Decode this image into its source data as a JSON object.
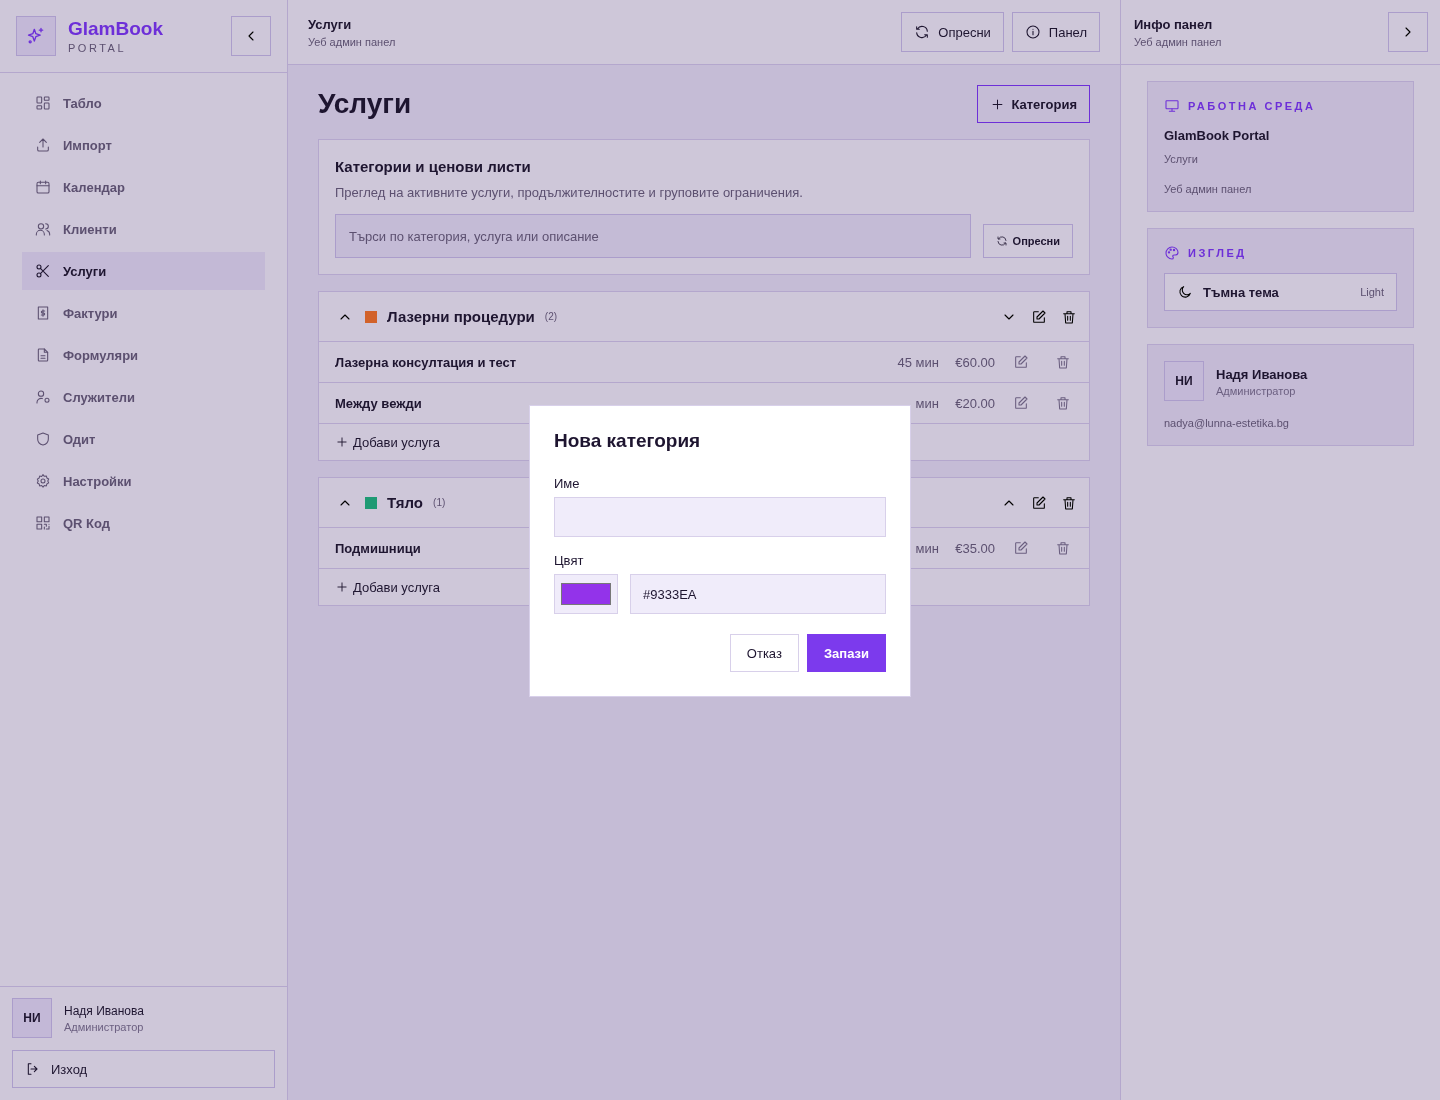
{
  "sidebar": {
    "brand": {
      "name": "GlamBook",
      "tagline": "PORTAL"
    },
    "items": [
      {
        "label": "Табло",
        "selected": false
      },
      {
        "label": "Импорт",
        "selected": false
      },
      {
        "label": "Календар",
        "selected": false
      },
      {
        "label": "Клиенти",
        "selected": false
      },
      {
        "label": "Услуги",
        "selected": true
      },
      {
        "label": "Фактури",
        "selected": false
      },
      {
        "label": "Формуляри",
        "selected": false
      },
      {
        "label": "Служители",
        "selected": false
      },
      {
        "label": "Одит",
        "selected": false
      },
      {
        "label": "Настройки",
        "selected": false
      },
      {
        "label": "QR Код",
        "selected": false
      }
    ],
    "user": {
      "initials": "НИ",
      "name": "Надя Иванова",
      "role": "Администратор"
    },
    "logout": "Изход"
  },
  "header": {
    "title": "Услуги",
    "subtitle": "Уеб админ панел",
    "buttons": [
      {
        "label": "Опресни"
      },
      {
        "label": "Панел"
      }
    ]
  },
  "page": {
    "title": "Услуги",
    "add_button": "Категория"
  },
  "intro_card": {
    "title": "Категории и ценови листи",
    "description": "Преглед на активните услуги, продължителностите и груповите ограничения.",
    "search": {
      "placeholder": "Търси по категория, услуга или описание"
    },
    "refresh_button": "Опресни"
  },
  "categories": [
    {
      "name": "Лазерни процедури",
      "count": "(2)",
      "color": "#d2622a",
      "expanded": true,
      "add_label": "Добави услуга",
      "services": [
        {
          "name": "Лазерна консултация и тест",
          "duration": "45 мин",
          "price": "€60.00"
        },
        {
          "name": "Между вежди",
          "duration": "мин",
          "price": "€20.00"
        }
      ]
    },
    {
      "name": "Тяло",
      "count": "(1)",
      "color": "#1f9a74",
      "expanded": true,
      "add_label": "Добави услуга",
      "services": [
        {
          "name": "Подмишници",
          "duration": "мин",
          "price": "€35.00"
        }
      ]
    }
  ],
  "info_panel": {
    "title": "Инфо панел",
    "subtitle": "Уеб админ панел",
    "workspace": {
      "heading": "РАБОТНА СРЕДА",
      "name": "GlamBook Portal",
      "section": "Услуги",
      "subtitle": "Уеб админ панел"
    },
    "appearance": {
      "heading": "ИЗГЛЕД",
      "theme_label": "Тъмна тема",
      "theme_value": "Light"
    },
    "user": {
      "initials": "НИ",
      "name": "Надя Иванова",
      "role": "Администратор",
      "email": "nadya@lunna-estetika.bg"
    }
  },
  "modal": {
    "title": "Нова категория",
    "name_label": "Име",
    "color_label": "Цвят",
    "color_value": "#9333EA",
    "buttons": [
      {
        "label": "Отказ",
        "kind": "secondary"
      },
      {
        "label": "Запази",
        "kind": "primary"
      }
    ]
  }
}
